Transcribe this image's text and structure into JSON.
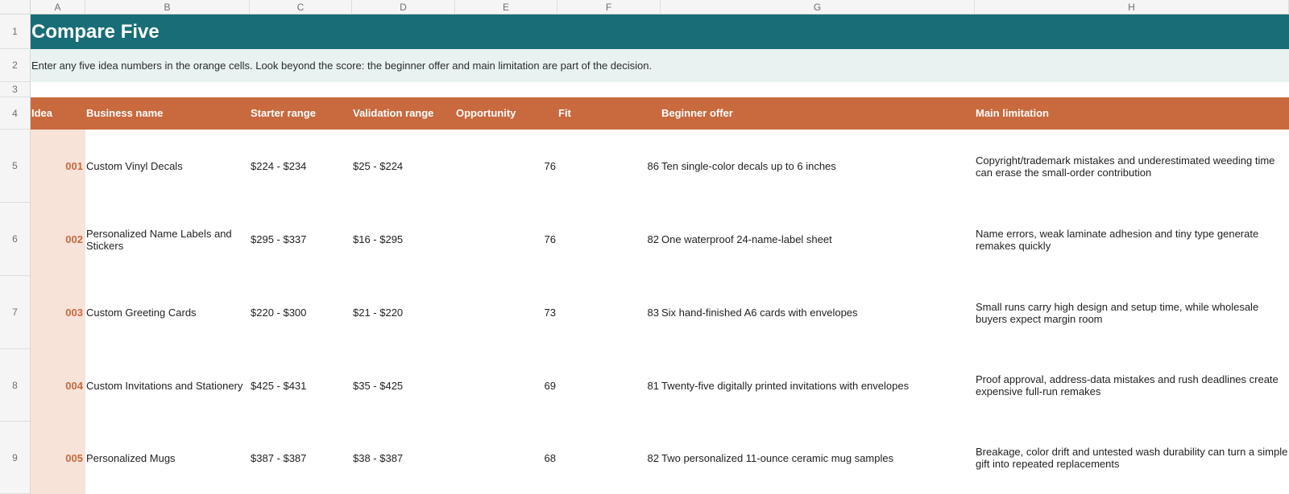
{
  "columns": [
    "A",
    "B",
    "C",
    "D",
    "E",
    "F",
    "G",
    "H"
  ],
  "row_numbers": [
    "1",
    "2",
    "3",
    "4",
    "5",
    "6",
    "7",
    "8",
    "9"
  ],
  "title": "Compare Five",
  "instructions": "Enter any five idea numbers in the orange cells. Look beyond the score: the beginner offer and main limitation are part of the decision.",
  "headers": {
    "idea": "Idea",
    "business_name": "Business name",
    "starter_range": "Starter range",
    "validation_range": "Validation range",
    "opportunity": "Opportunity",
    "fit": "Fit",
    "beginner_offer": "Beginner offer",
    "main_limitation": "Main limitation"
  },
  "rows": [
    {
      "idea": "001",
      "business_name": "Custom Vinyl Decals",
      "starter_range": "$224 - $234",
      "validation_range": "$25 - $224",
      "opportunity": "76",
      "fit": "86",
      "beginner_offer": "Ten single-color decals up to 6 inches",
      "main_limitation": "Copyright/trademark mistakes and underestimated weeding time can erase the small-order contribution"
    },
    {
      "idea": "002",
      "business_name": "Personalized Name Labels and Stickers",
      "starter_range": "$295 - $337",
      "validation_range": "$16 - $295",
      "opportunity": "76",
      "fit": "82",
      "beginner_offer": "One waterproof 24-name-label sheet",
      "main_limitation": "Name errors, weak laminate adhesion and tiny type generate remakes quickly"
    },
    {
      "idea": "003",
      "business_name": "Custom Greeting Cards",
      "starter_range": "$220 - $300",
      "validation_range": "$21 - $220",
      "opportunity": "73",
      "fit": "83",
      "beginner_offer": "Six hand-finished A6 cards with envelopes",
      "main_limitation": "Small runs carry high design and setup time, while wholesale buyers expect margin room"
    },
    {
      "idea": "004",
      "business_name": "Custom Invitations and Stationery",
      "starter_range": "$425 - $431",
      "validation_range": "$35 - $425",
      "opportunity": "69",
      "fit": "81",
      "beginner_offer": "Twenty-five digitally printed invitations with envelopes",
      "main_limitation": "Proof approval, address-data mistakes and rush deadlines create expensive full-run remakes"
    },
    {
      "idea": "005",
      "business_name": "Personalized Mugs",
      "starter_range": "$387 - $387",
      "validation_range": "$38 - $387",
      "opportunity": "68",
      "fit": "82",
      "beginner_offer": "Two personalized 11-ounce ceramic mug samples",
      "main_limitation": "Breakage, color drift and untested wash durability can turn a simple gift into repeated replacements"
    }
  ],
  "colors": {
    "title_band": "#186d77",
    "note_band": "#e8f3f1",
    "header_band": "#c8693e",
    "idea_input_fill": "#f8e3d9",
    "idea_number_text": "#c8693e"
  }
}
